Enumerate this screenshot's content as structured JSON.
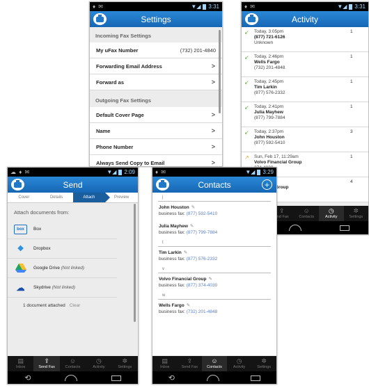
{
  "settings": {
    "status_time": "3:31",
    "title": "Settings",
    "incoming_header": "Incoming Fax Settings",
    "rows_incoming": [
      {
        "label": "My uFax Number",
        "value": "(732) 201-4840"
      },
      {
        "label": "Forwarding Email Address",
        "chevron": ">"
      },
      {
        "label": "Forward as",
        "chevron": ">"
      }
    ],
    "outgoing_header": "Outgoing Fax Settings",
    "rows_outgoing": [
      {
        "label": "Default Cover Page",
        "chevron": ">"
      },
      {
        "label": "Name",
        "chevron": ">"
      },
      {
        "label": "Phone Number",
        "chevron": ">"
      },
      {
        "label": "Always Send Copy to Email",
        "chevron": ">"
      }
    ]
  },
  "activity": {
    "status_time": "3:31",
    "title": "Activity",
    "items": [
      {
        "time": "Today, 3:05pm",
        "name": "(877) 721-6126",
        "sub": "Unknown",
        "count": "1"
      },
      {
        "time": "Today, 2:46pm",
        "name": "Wells Fargo",
        "sub": "(732) 201-4848",
        "count": "1"
      },
      {
        "time": "Today, 2:45pm",
        "name": "Tim Larkin",
        "sub": "(877) 576-2332",
        "count": "1"
      },
      {
        "time": "Today, 2:41pm",
        "name": "Julia Mayhew",
        "sub": "(877) 799-7884",
        "count": "1"
      },
      {
        "time": "Today, 2:37pm",
        "name": "John Houston",
        "sub": "(877) 592-5410",
        "count": "3"
      },
      {
        "time": "Sun, Feb 17, 11:29am",
        "name": "Volvo Financial Group",
        "sub": "374-4030",
        "count": "1"
      },
      {
        "time": "15, 2:22pm",
        "name": "Financial Group",
        "sub": "374-4030",
        "count": "4"
      }
    ],
    "nav": [
      "end Fax",
      "Contacts",
      "Activity",
      "Settings"
    ]
  },
  "send": {
    "status_time": "2:09",
    "title": "Send",
    "tabs": [
      "Cover",
      "Details",
      "Attach",
      "Preview"
    ],
    "attach_title": "Attach documents from:",
    "services": [
      {
        "icon": "box",
        "label": "Box",
        "note": ""
      },
      {
        "icon": "",
        "label": "Dropbox",
        "note": ""
      },
      {
        "icon": "",
        "label": "Google Drive",
        "note": "(Not linked)"
      },
      {
        "icon": "",
        "label": "Skydrive",
        "note": "(Not linked)"
      }
    ],
    "attached_text": "1 document attached",
    "clear_label": "Clear",
    "nav": [
      "Inbox",
      "Send Fax",
      "Contacts",
      "Activity",
      "Settings"
    ]
  },
  "contacts": {
    "status_time": "3:29",
    "title": "Contacts",
    "add_symbol": "+",
    "groups": [
      {
        "letter": "j",
        "items": [
          {
            "name": "John Houston",
            "fax_label": "business fax:",
            "fax": "(877) 592-5410"
          },
          {
            "name": "Julia Mayhew",
            "fax_label": "business fax:",
            "fax": "(877) 799-7884"
          }
        ]
      },
      {
        "letter": "t",
        "items": [
          {
            "name": "Tim Larkin",
            "fax_label": "business fax:",
            "fax": "(877) 576-2332"
          }
        ]
      },
      {
        "letter": "v",
        "items": [
          {
            "name": "Volvo Financial Group",
            "fax_label": "business fax:",
            "fax": "(877) 374-4030"
          }
        ]
      },
      {
        "letter": "w",
        "items": [
          {
            "name": "Wells Fargo",
            "fax_label": "business fax:",
            "fax": "(732) 201-4848"
          }
        ]
      }
    ],
    "nav": [
      "Inbox",
      "Send Fax",
      "Contacts",
      "Activity",
      "Settings"
    ]
  },
  "colors": {
    "accent": "#1f78c8",
    "nav_bg": "#141414"
  }
}
